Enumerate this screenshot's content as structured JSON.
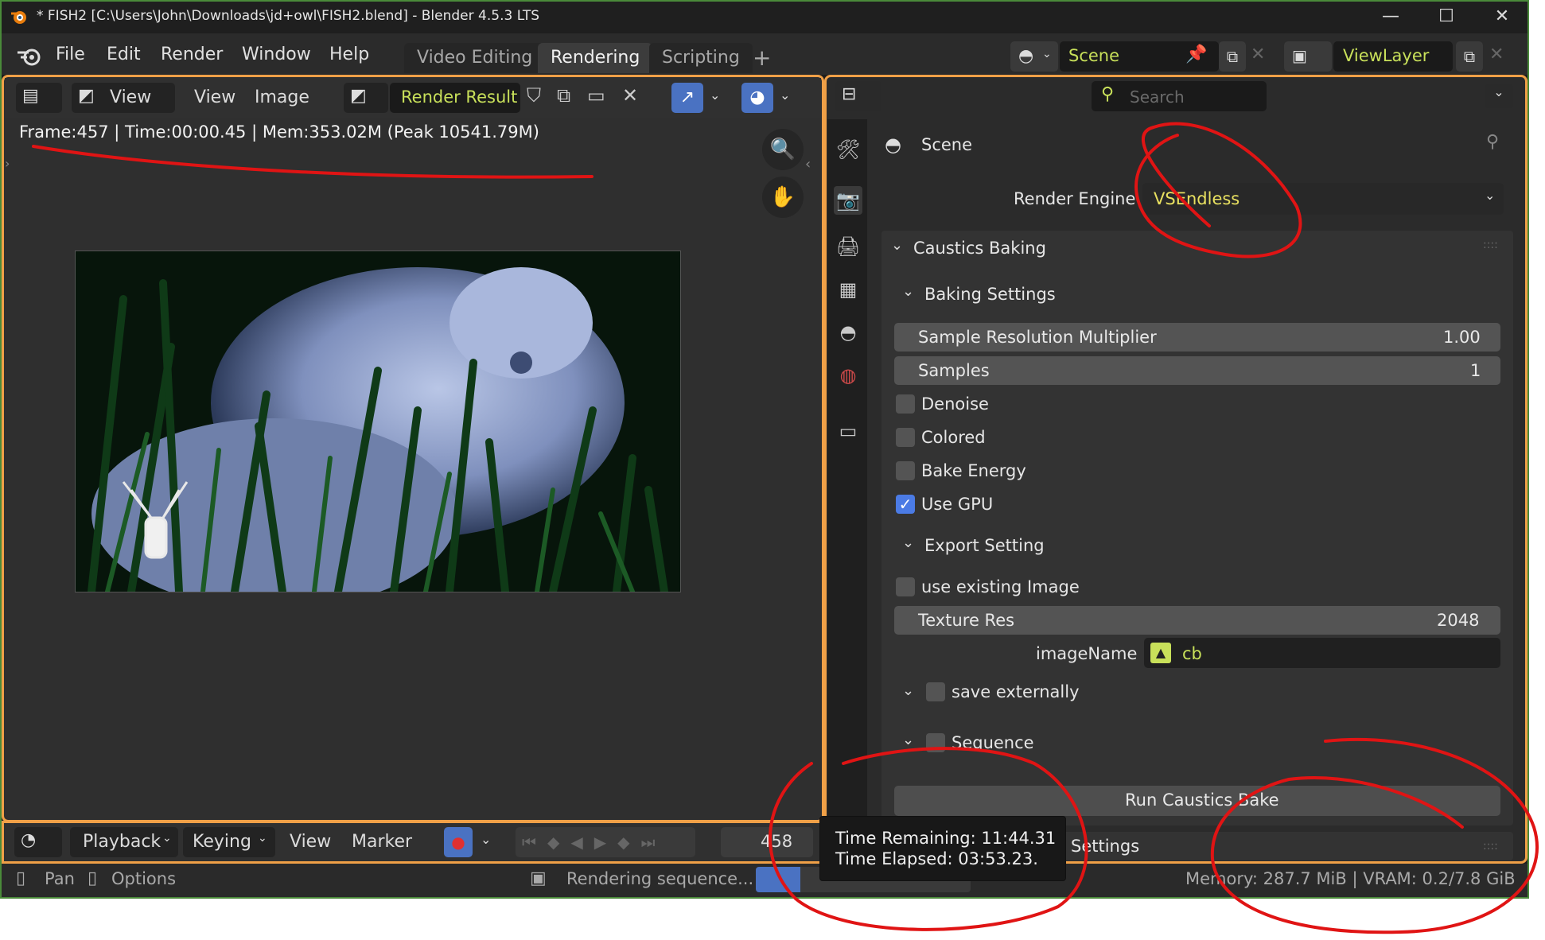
{
  "window": {
    "title": "* FISH2 [C:\\Users\\John\\Downloads\\jd+owl\\FISH2.blend] - Blender 4.5.3 LTS",
    "minimize_icon": "minimize-icon",
    "maximize_icon": "maximize-icon",
    "close_icon": "close-icon"
  },
  "menu": {
    "items": [
      "File",
      "Edit",
      "Render",
      "Window",
      "Help"
    ],
    "workspaces": [
      "Video Editing",
      "Rendering",
      "Scripting"
    ],
    "active_workspace": "Rendering",
    "add_workspace": "+",
    "scene_name": "Scene",
    "viewlayer_name": "ViewLayer"
  },
  "image_editor": {
    "view_label": "View",
    "menu_view": "View",
    "menu_image": "Image",
    "image_name": "Render Result",
    "frame_info": "Frame:457 | Time:00:00.45 | Mem:353.02M (Peak 10541.79M)"
  },
  "timeline": {
    "playback": "Playback",
    "keying": "Keying",
    "view": "View",
    "marker": "Marker",
    "current_frame": "458"
  },
  "status": {
    "pan": "Pan",
    "options": "Options",
    "job": "Rendering sequence...",
    "memory": "Memory: 287.7 MiB | VRAM: 0.2/7.8 GiB"
  },
  "tooltip": {
    "remaining": "Time Remaining: 11:44.31",
    "elapsed": "Time Elapsed: 03:53.23."
  },
  "properties": {
    "search_placeholder": "Search",
    "context": "Scene",
    "render_engine_label": "Render Engine",
    "render_engine_value": "VSEndless",
    "caustics_panel": "Caustics Baking",
    "baking_settings": "Baking Settings",
    "sample_res_label": "Sample Resolution Multiplier",
    "sample_res_value": "1.00",
    "samples_label": "Samples",
    "samples_value": "1",
    "denoise": "Denoise",
    "colored": "Colored",
    "bake_energy": "Bake Energy",
    "use_gpu": "Use GPU",
    "export_setting": "Export Setting",
    "use_existing_image": "use existing Image",
    "texture_res_label": "Texture Res",
    "texture_res_value": "2048",
    "image_name_label": "imageName",
    "image_name_value": "cb",
    "save_externally": "save externally",
    "sequence": "Sequence",
    "run_button": "Run Caustics Bake",
    "next_panel_partial": "Settings"
  },
  "colors": {
    "accent_orange": "#f0a047",
    "highlight_yellow": "#c8e05a",
    "checkbox_blue": "#4b7be5",
    "annotation_red": "#e01414"
  }
}
